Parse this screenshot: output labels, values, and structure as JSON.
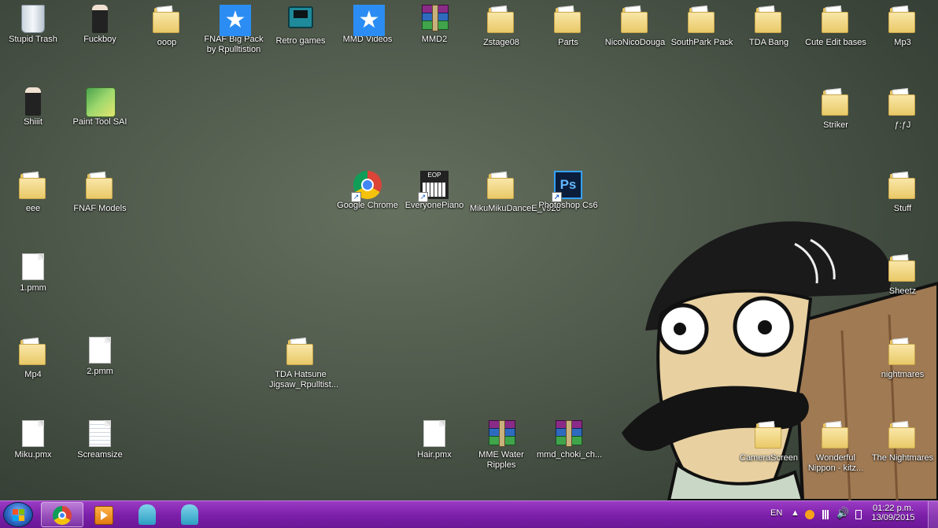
{
  "desktop": {
    "icons": [
      {
        "label": "Stupid Trash",
        "icon": "recycle-bin-icon"
      },
      {
        "label": "Fuckboy",
        "icon": "image-icon"
      },
      {
        "label": "ooop",
        "icon": "folder-icon"
      },
      {
        "label": "FNAF Big Pack by Rpulltistion",
        "icon": "mmd-star-icon"
      },
      {
        "label": "Retro games",
        "icon": "console-icon"
      },
      {
        "label": "MMD Videos",
        "icon": "mmd-star-icon"
      },
      {
        "label": "MMD2",
        "icon": "winrar-icon"
      },
      {
        "label": "Zstage08",
        "icon": "folder-icon"
      },
      {
        "label": "Parts",
        "icon": "folder-icon"
      },
      {
        "label": "NicoNicoDouga",
        "icon": "folder-icon"
      },
      {
        "label": "SouthPark Pack",
        "icon": "folder-icon"
      },
      {
        "label": "TDA Bang",
        "icon": "folder-icon"
      },
      {
        "label": "Cute Edit bases",
        "icon": "folder-icon"
      },
      {
        "label": "Mp3",
        "icon": "folder-icon"
      },
      {
        "label": "Shiiit",
        "icon": "image-icon"
      },
      {
        "label": "Paint Tool SAI",
        "icon": "paint-tool-icon"
      },
      {
        "label": "Striker",
        "icon": "folder-icon"
      },
      {
        "label": "ƒ:ƒJ",
        "icon": "folder-icon"
      },
      {
        "label": "eee",
        "icon": "folder-icon"
      },
      {
        "label": "FNAF Models",
        "icon": "folder-icon"
      },
      {
        "label": "Google Chrome",
        "icon": "chrome-icon"
      },
      {
        "label": "EveryonePiano",
        "icon": "piano-icon"
      },
      {
        "label": "MikuMikuDanceE_v926",
        "icon": "folder-icon"
      },
      {
        "label": "Photoshop Cs6",
        "icon": "photoshop-icon"
      },
      {
        "label": "Stuff",
        "icon": "folder-icon"
      },
      {
        "label": "1.pmm",
        "icon": "file-icon"
      },
      {
        "label": "Sheetz",
        "icon": "folder-icon"
      },
      {
        "label": "Mp4",
        "icon": "folder-icon"
      },
      {
        "label": "2.pmm",
        "icon": "file-icon"
      },
      {
        "label": "TDA Hatsune Jigsaw_Rpulltist...",
        "icon": "folder-icon"
      },
      {
        "label": "nightmares",
        "icon": "folder-icon"
      },
      {
        "label": "Miku.pmx",
        "icon": "file-icon"
      },
      {
        "label": "Screamsize",
        "icon": "text-file-icon"
      },
      {
        "label": "Hair.pmx",
        "icon": "file-icon"
      },
      {
        "label": "MME Water Ripples",
        "icon": "winrar-icon"
      },
      {
        "label": "mmd_choki_ch...",
        "icon": "winrar-icon"
      },
      {
        "label": "CameraScreen",
        "icon": "folder-icon"
      },
      {
        "label": "Wonderful Nippon - kitz...",
        "icon": "folder-icon"
      },
      {
        "label": "The Nightmares",
        "icon": "folder-icon"
      }
    ]
  },
  "taskbar": {
    "start_icon": "windows-start-icon",
    "pinned": [
      {
        "name": "Google Chrome",
        "icon": "chrome-icon"
      },
      {
        "name": "Media Player",
        "icon": "media-player-icon"
      },
      {
        "name": "MikuMikuDance",
        "icon": "mmd-icon"
      },
      {
        "name": "MikuMikuDance 2",
        "icon": "mmd-icon"
      }
    ],
    "tray": {
      "language": "EN",
      "time": "01:22 p.m.",
      "date": "13/09/2015"
    }
  },
  "colors": {
    "taskbar": "#7b1fa8",
    "desktop_background": "#4f5a4c"
  }
}
